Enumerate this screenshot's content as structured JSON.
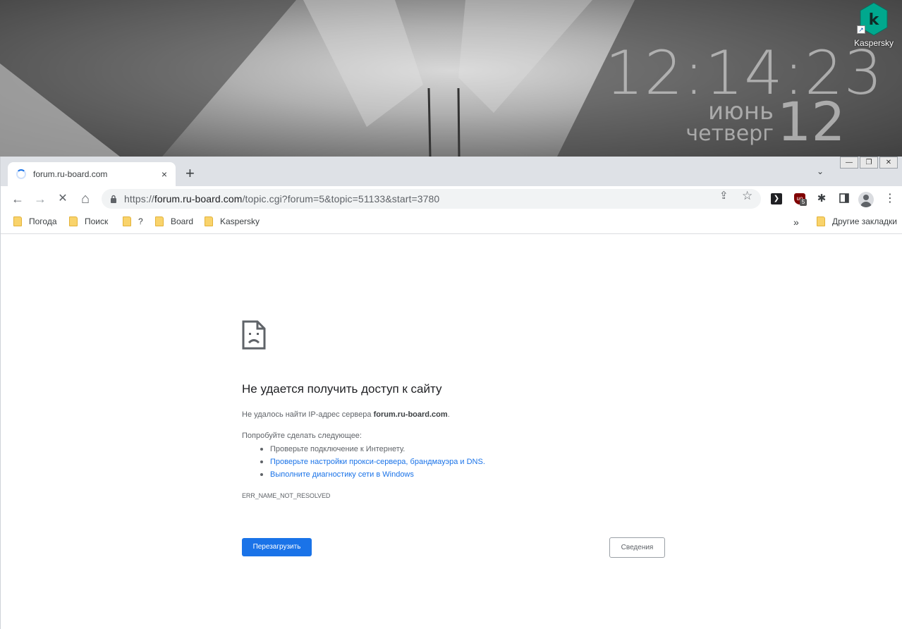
{
  "desktop": {
    "clock": {
      "time": "12:14:23",
      "month": "июнь",
      "weekday": "четверг",
      "day": "12"
    },
    "icons": [
      {
        "label": "Kaspersky",
        "glyph": "k",
        "color": "#00a88e"
      }
    ]
  },
  "window_controls": {
    "minimize": "—",
    "restore": "❐",
    "close": "✕"
  },
  "tabs": [
    {
      "title": "forum.ru-board.com",
      "close": "×"
    }
  ],
  "new_tab": "+",
  "tab_menu": "⌄",
  "toolbar": {
    "back": "←",
    "forward": "→",
    "stop": "✕",
    "home": "⌂",
    "url_scheme": "https://",
    "url_host": "forum.ru-board.com",
    "url_path": "/topic.cgi?forum=5&topic=51133&start=3780",
    "share": "⇪",
    "star": "☆",
    "extensions": {
      "ublock_badge": "5"
    },
    "menu": "⋮"
  },
  "bookmarks": {
    "items": [
      "Погода",
      "Поиск",
      "?",
      "Board",
      "Kaspersky"
    ],
    "more": "»",
    "other": "Другие закладки"
  },
  "error": {
    "title": "Не удается получить доступ к сайту",
    "desc_prefix": "Не удалось найти IP-адрес сервера ",
    "desc_host": "forum.ru-board.com",
    "desc_suffix": ".",
    "try_label": "Попробуйте сделать следующее:",
    "suggestions": [
      "Проверьте подключение к Интернету.",
      "Проверьте настройки прокси-сервера, брандмауэра и DNS.",
      "Выполните диагностику сети в Windows"
    ],
    "code": "ERR_NAME_NOT_RESOLVED",
    "reload_button": "Перезагрузить",
    "details_button": "Сведения"
  },
  "colors": {
    "accent": "#1a73e8",
    "tabstrip": "#dee1e6",
    "omnibox": "#f1f3f4"
  }
}
